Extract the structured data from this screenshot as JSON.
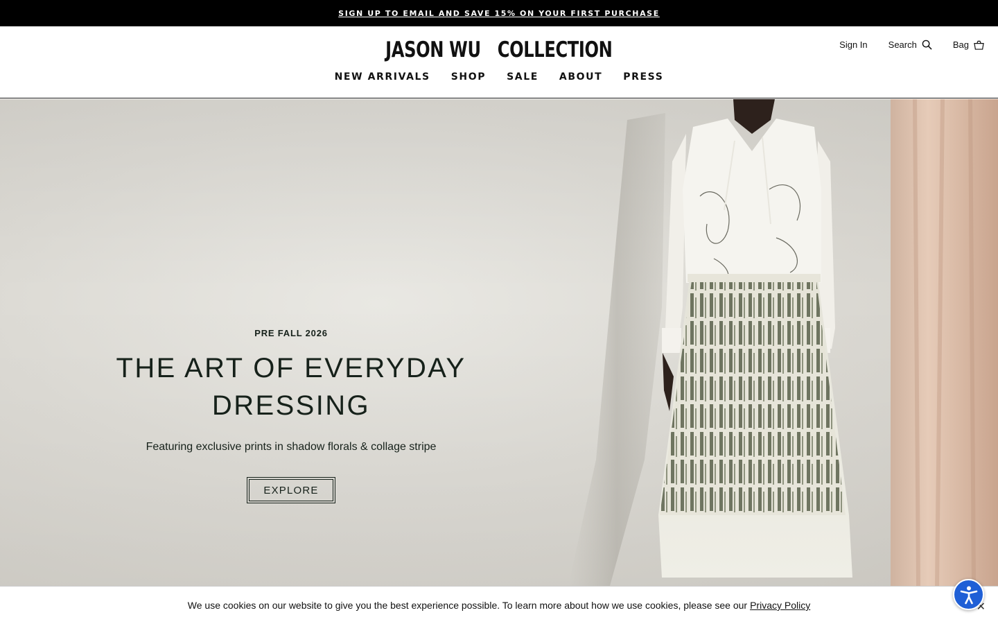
{
  "promo": {
    "text": "SIGN UP TO EMAIL AND SAVE 15% ON YOUR FIRST PURCHASE"
  },
  "header": {
    "logo": "JASON WU   COLLECTION",
    "sign_in": "Sign In",
    "search": "Search",
    "bag": "Bag"
  },
  "nav": {
    "items": [
      "NEW ARRIVALS",
      "SHOP",
      "SALE",
      "ABOUT",
      "PRESS"
    ]
  },
  "hero": {
    "eyebrow": "PRE FALL 2026",
    "headline_line1": "THE ART OF EVERYDAY",
    "headline_line2": "DRESSING",
    "subhead": "Featuring exclusive prints in shadow florals & collage stripe",
    "cta": "EXPLORE"
  },
  "cookie": {
    "text": "We use cookies on our website to give you the best experience possible. To learn more about how we use cookies, please see our",
    "link": "Privacy Policy",
    "close": "✕"
  },
  "icons": {
    "search": "search-icon",
    "bag": "bag-icon",
    "accessibility": "accessibility-icon",
    "close": "close-icon"
  },
  "colors": {
    "promo_bg": "#000000",
    "text_dark": "#16211a",
    "a11y_blue": "#1f5fd6",
    "curtain": "#d9b9a5"
  }
}
